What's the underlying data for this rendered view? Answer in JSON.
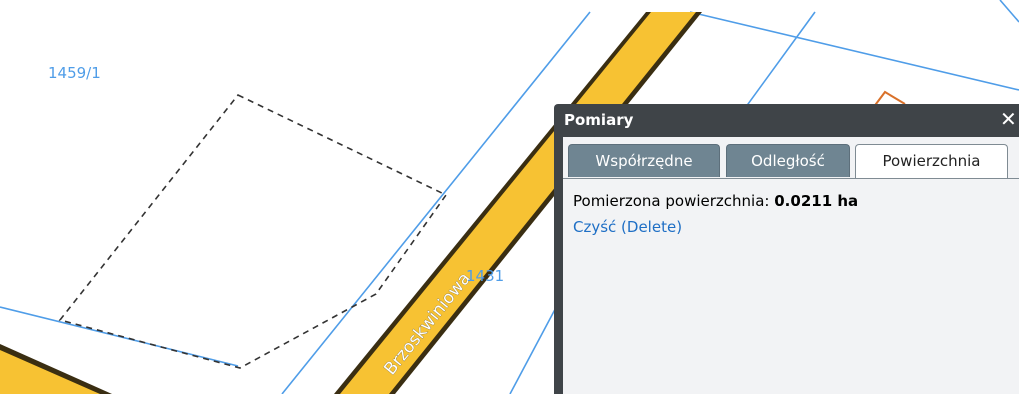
{
  "map": {
    "parcel_labels": [
      "1459/1",
      "1431"
    ],
    "street_name": "Brzoskwiniowa",
    "colors": {
      "road_fill": "#f7c233",
      "road_edge": "#3a2e12",
      "parcel_line": "#4f9de8",
      "measure_outline": "#333333",
      "building": "#d9712a"
    }
  },
  "panel": {
    "title": "Pomiary",
    "close_label": "✕",
    "tabs": [
      {
        "label": "Współrzędne",
        "active": false
      },
      {
        "label": "Odległość",
        "active": false
      },
      {
        "label": "Powierzchnia",
        "active": true
      }
    ],
    "result": {
      "label": "Pomierzona powierzchnia:",
      "value": "0.0211 ha"
    },
    "clear_link": "Czyść (Delete)"
  }
}
